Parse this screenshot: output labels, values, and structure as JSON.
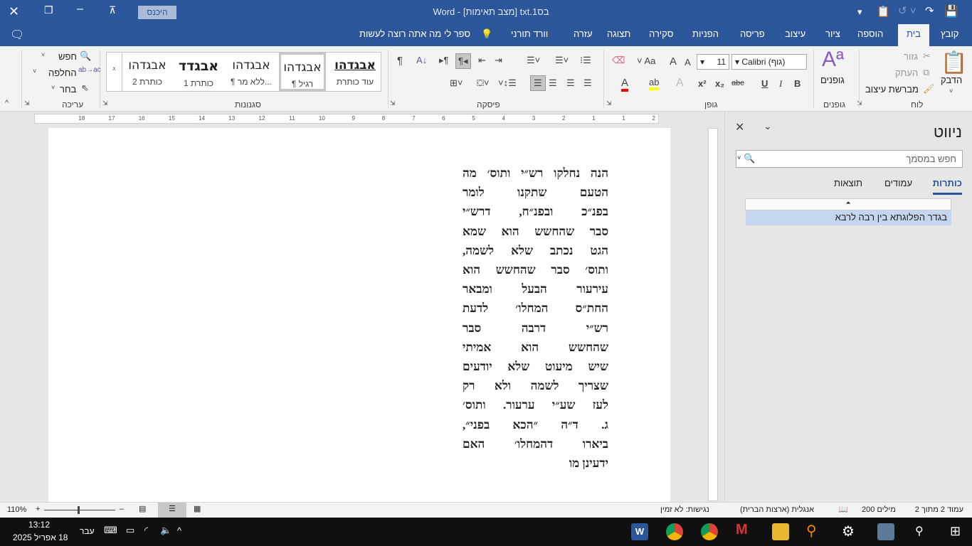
{
  "titlebar": {
    "title": "בס1.txt [מצב תאימות]  -  Word",
    "signin": "היכנס",
    "colors": {
      "accent": "#2b579a"
    }
  },
  "tabs": [
    "קובץ",
    "בית",
    "הוספה",
    "ציור",
    "עיצוב",
    "פריסה",
    "הפניות",
    "סקירה",
    "תצוגה",
    "עזרה",
    "וורד תורני"
  ],
  "tellme": "ספר לי מה אתה רוצה לעשות",
  "ribbon": {
    "clipboard": {
      "label": "לוח",
      "paste": "הדבק",
      "cut": "גזור",
      "copy": "העתק",
      "format_painter": "מברשת עיצוב"
    },
    "fonts_group": {
      "label": "גופנים",
      "button": "גופנים"
    },
    "font": {
      "label": "גופן",
      "font_name": "Calibri (גוף)",
      "font_size": "11",
      "change_case": "Aa",
      "bold": "B",
      "italic": "I",
      "underline": "U",
      "strike": "abc",
      "subscript": "x₂",
      "superscript": "x²"
    },
    "paragraph": {
      "label": "פיסקה"
    },
    "styles": {
      "label": "סגנונות",
      "items": [
        {
          "preview": "אבגדהו",
          "name": "עוד כותרת"
        },
        {
          "preview": "אבגדהו",
          "name": "¶ רגיל"
        },
        {
          "preview": "אבגדהו",
          "name": "¶ ללא מר..."
        },
        {
          "preview": "אבגדד",
          "name": "כותרת 1"
        },
        {
          "preview": "אבגדהו",
          "name": "כותרת 2"
        }
      ]
    },
    "editing": {
      "label": "עריכה",
      "find": "חפש",
      "replace": "החלפה",
      "select": "בחר"
    }
  },
  "ruler": {
    "numbers": [
      "2",
      "1",
      "1",
      "2",
      "3",
      "4",
      "5",
      "6",
      "7",
      "8",
      "9",
      "10",
      "11",
      "12",
      "13",
      "14",
      "15",
      "16",
      "17",
      "18"
    ]
  },
  "document": {
    "lines": [
      "הנה נחלקו רש״י ותוס׳ מה",
      "הטעם שתקנו לומר",
      "בפנ״כ ובפנ״ח, דרש״י",
      "סבר שהחשש הוא שמא",
      "הגט נכתב שלא לשמה,",
      "ותוס׳ סבר שהחשש הוא",
      "עירעור הבעל ומבאר",
      "החת״ס המחלו׳ לדעת",
      "רש״י דרבה סבר",
      "שהחשש הוא אמיתי",
      "שיש מיעוט שלא יודעים",
      "שצריך לשמה ולא רק",
      "לעז שע״י ערעור. ותוס׳",
      "ג. ד״ה ״הכא בפני״,",
      "ביארו דהמחלו׳ האם",
      "ידעינן מו"
    ]
  },
  "nav": {
    "title": "ניווט",
    "search_placeholder": "חפש במסמך",
    "tabs": [
      "כותרות",
      "עמודים",
      "תוצאות"
    ],
    "headings": [
      "בגדר הפלוגתא בין רבה לרבא"
    ]
  },
  "status": {
    "page": "עמוד 2 מתוך 2",
    "words": "200 מילים",
    "language": "אנגלית (ארצות הברית)",
    "accessibility": "נגישות: לא זמין",
    "zoom": "110%"
  },
  "taskbar": {
    "time": "13:12",
    "date": "18 אפריל 2025",
    "lang": "עבר"
  }
}
